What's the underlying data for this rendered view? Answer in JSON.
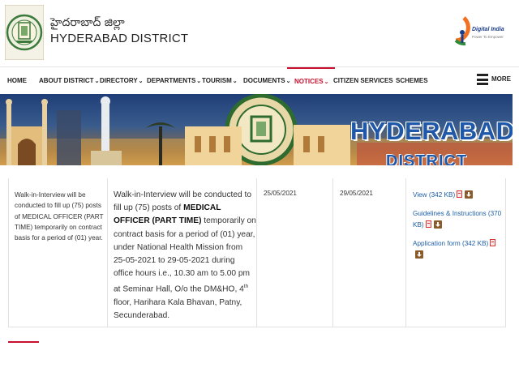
{
  "header": {
    "district_telugu": "హైదరాబాద్ జిల్లా",
    "district_name": "HYDERABAD DISTRICT",
    "digital_india": "Digital India",
    "digital_india_tagline": "Power To Empower"
  },
  "nav": {
    "items": [
      {
        "label": "HOME",
        "dropdown": false
      },
      {
        "label": "ABOUT DISTRICT",
        "dropdown": true
      },
      {
        "label": "DIRECTORY",
        "dropdown": true
      },
      {
        "label": "DEPARTMENTS",
        "dropdown": true
      },
      {
        "label": "TOURISM",
        "dropdown": true
      },
      {
        "label": "DOCUMENTS",
        "dropdown": true
      },
      {
        "label": "NOTICES",
        "dropdown": true,
        "active": true
      },
      {
        "label": "CITIZEN SERVICES",
        "dropdown": false
      },
      {
        "label": "SCHEMES",
        "dropdown": false
      }
    ],
    "more_label": "MORE",
    "active_color": "#c8102e"
  },
  "banner": {
    "title": "HYDERABAD",
    "subtitle": "DISTRICT",
    "title_color": "#1f58a8"
  },
  "notice": {
    "title": "Walk-in-Interview will be conducted to fill up (75) posts of MEDICAL OFFICER (PART TIME) temporarily on contract basis for a period of (01) year.",
    "desc_part1": "Walk-in-Interview will be conducted to fill up (75) posts of ",
    "desc_bold": "MEDICAL OFFICER (PART TIME)",
    "desc_part2": " temporarily on contract basis for a period of (01) year, under National Health Mission from 25-05-2021 to 29-05-2021 during office hours i.e., 10.30 am to 5.00 pm at Seminar Hall, O/o the DM&HO, 4",
    "desc_sup": "th",
    "desc_part3": " floor, Harihara Kala Bhavan, Patny, Secunderabad.",
    "start_date": "25/05/2021",
    "end_date": "29/05/2021",
    "downloads": [
      {
        "label": "View (342 KB)"
      },
      {
        "label": "Guidelines & Instructions (370 KB)"
      },
      {
        "label": "Application form (342 KB)"
      }
    ]
  }
}
